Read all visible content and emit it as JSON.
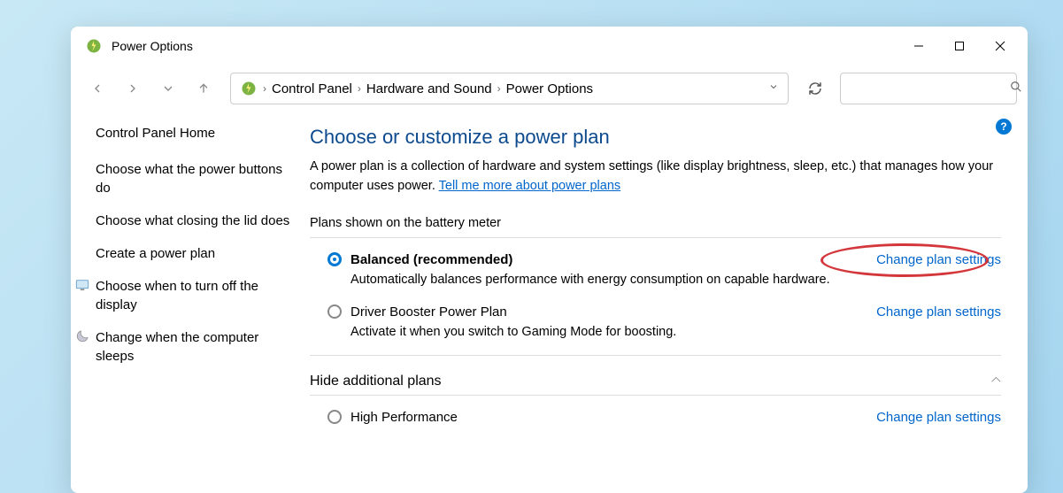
{
  "window": {
    "title": "Power Options"
  },
  "breadcrumb": {
    "items": [
      "Control Panel",
      "Hardware and Sound",
      "Power Options"
    ]
  },
  "sidebar": {
    "home": "Control Panel Home",
    "links": [
      {
        "label": "Choose what the power buttons do",
        "icon": null
      },
      {
        "label": "Choose what closing the lid does",
        "icon": null
      },
      {
        "label": "Create a power plan",
        "icon": null
      },
      {
        "label": "Choose when to turn off the display",
        "icon": "display"
      },
      {
        "label": "Change when the computer sleeps",
        "icon": "moon"
      }
    ]
  },
  "main": {
    "heading": "Choose or customize a power plan",
    "description_prefix": "A power plan is a collection of hardware and system settings (like display brightness, sleep, etc.) that manages how your computer uses power. ",
    "description_link": "Tell me more about power plans",
    "section_shown": "Plans shown on the battery meter",
    "plans": [
      {
        "name": "Balanced (recommended)",
        "selected": true,
        "description": "Automatically balances performance with energy consumption on capable hardware.",
        "action": "Change plan settings",
        "highlighted": true
      },
      {
        "name": "Driver Booster Power Plan",
        "selected": false,
        "description": "Activate it when you switch to Gaming Mode for boosting.",
        "action": "Change plan settings",
        "highlighted": false
      }
    ],
    "section_hidden": "Hide additional plans",
    "hidden_plans": [
      {
        "name": "High Performance",
        "selected": false,
        "description": "",
        "action": "Change plan settings"
      }
    ]
  },
  "help_tooltip": "?"
}
